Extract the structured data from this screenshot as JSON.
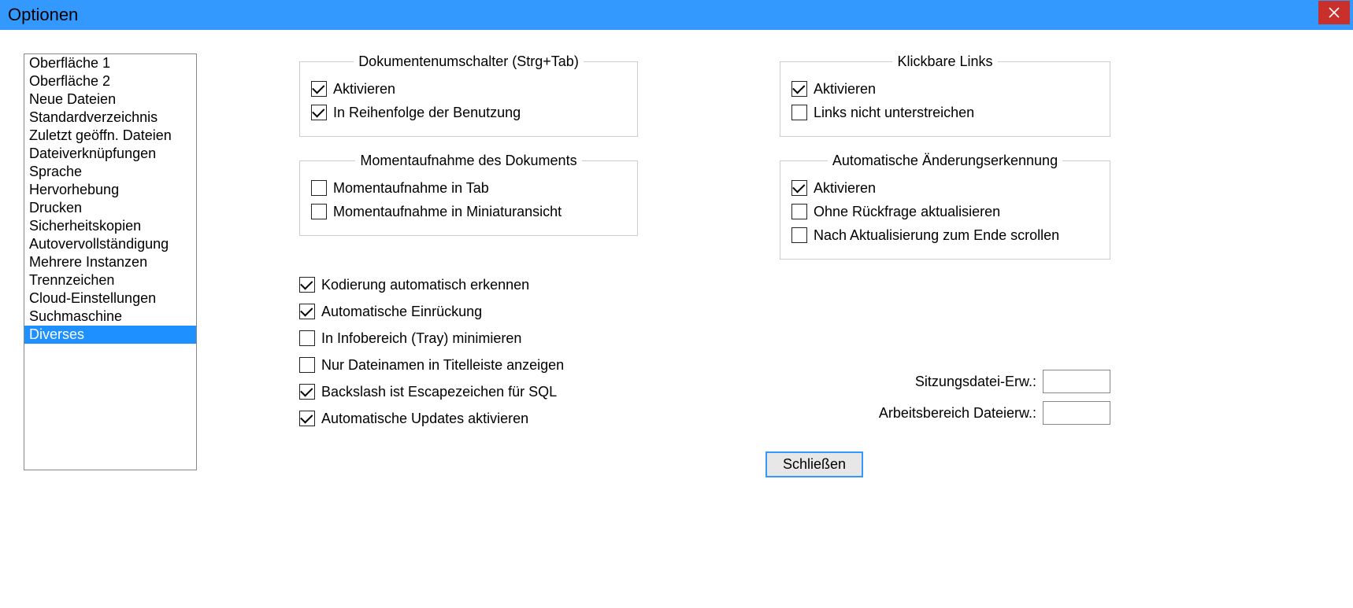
{
  "window": {
    "title": "Optionen",
    "close_icon": "close-icon"
  },
  "sidebar": {
    "items": [
      {
        "label": "Oberfläche 1"
      },
      {
        "label": "Oberfläche 2"
      },
      {
        "label": "Neue Dateien"
      },
      {
        "label": "Standardverzeichnis"
      },
      {
        "label": "Zuletzt geöffn. Dateien"
      },
      {
        "label": "Dateiverknüpfungen"
      },
      {
        "label": "Sprache"
      },
      {
        "label": "Hervorhebung"
      },
      {
        "label": "Drucken"
      },
      {
        "label": "Sicherheitskopien"
      },
      {
        "label": "Autovervollständigung"
      },
      {
        "label": "Mehrere Instanzen"
      },
      {
        "label": "Trennzeichen"
      },
      {
        "label": "Cloud-Einstellungen"
      },
      {
        "label": "Suchmaschine"
      },
      {
        "label": "Diverses",
        "selected": true
      }
    ]
  },
  "groups": {
    "doc_switcher": {
      "legend": "Dokumentenumschalter (Strg+Tab)",
      "items": [
        {
          "label": "Aktivieren",
          "checked": true
        },
        {
          "label": "In Reihenfolge der Benutzung",
          "checked": true
        }
      ]
    },
    "snapshot": {
      "legend": "Momentaufnahme des Dokuments",
      "items": [
        {
          "label": "Momentaufnahme in Tab",
          "checked": false
        },
        {
          "label": "Momentaufnahme in Miniaturansicht",
          "checked": false
        }
      ]
    },
    "clickable_links": {
      "legend": "Klickbare Links",
      "items": [
        {
          "label": "Aktivieren",
          "checked": true
        },
        {
          "label": "Links nicht unterstreichen",
          "checked": false
        }
      ]
    },
    "auto_change": {
      "legend": "Automatische Änderungserkennung",
      "items": [
        {
          "label": "Aktivieren",
          "checked": true
        },
        {
          "label": "Ohne Rückfrage aktualisieren",
          "checked": false
        },
        {
          "label": "Nach Aktualisierung zum Ende scrollen",
          "checked": false
        }
      ]
    }
  },
  "standalone_checks": [
    {
      "label": "Kodierung automatisch erkennen",
      "checked": true
    },
    {
      "label": "Automatische Einrückung",
      "checked": true
    },
    {
      "label": "In Infobereich (Tray) minimieren",
      "checked": false
    },
    {
      "label": "Nur Dateinamen in Titelleiste anzeigen",
      "checked": false
    },
    {
      "label": "Backslash ist Escapezeichen für SQL",
      "checked": true
    },
    {
      "label": "Automatische Updates aktivieren",
      "checked": true
    }
  ],
  "inputs": {
    "session_ext": {
      "label": "Sitzungsdatei-Erw.:",
      "value": ""
    },
    "workspace_ext": {
      "label": "Arbeitsbereich Dateierw.:",
      "value": ""
    }
  },
  "buttons": {
    "close": "Schließen"
  }
}
